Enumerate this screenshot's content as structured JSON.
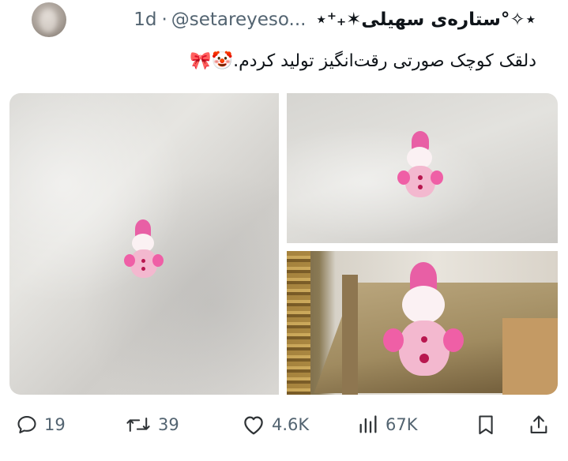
{
  "post": {
    "display_name": "⋆⁺₊✶ستاره‌ی سهیلی°✧⋆",
    "handle": "@setareyeso...",
    "separator": "·",
    "timestamp": "1d",
    "text": "دلقک کوچک صورتی رقت‌انگیز تولید کردم.🤡🎀"
  },
  "actions": {
    "replies": "19",
    "reposts": "39",
    "likes": "4.6K",
    "views": "67K"
  },
  "icons": {
    "reply": "comment-bubble-icon",
    "repost": "repost-arrows-icon",
    "like": "heart-icon",
    "views": "bar-chart-icon",
    "bookmark": "bookmark-icon",
    "share": "share-upload-icon"
  },
  "colors": {
    "text_primary": "#0f1419",
    "text_secondary": "#536471",
    "clown_pink": "#e85fa5"
  }
}
